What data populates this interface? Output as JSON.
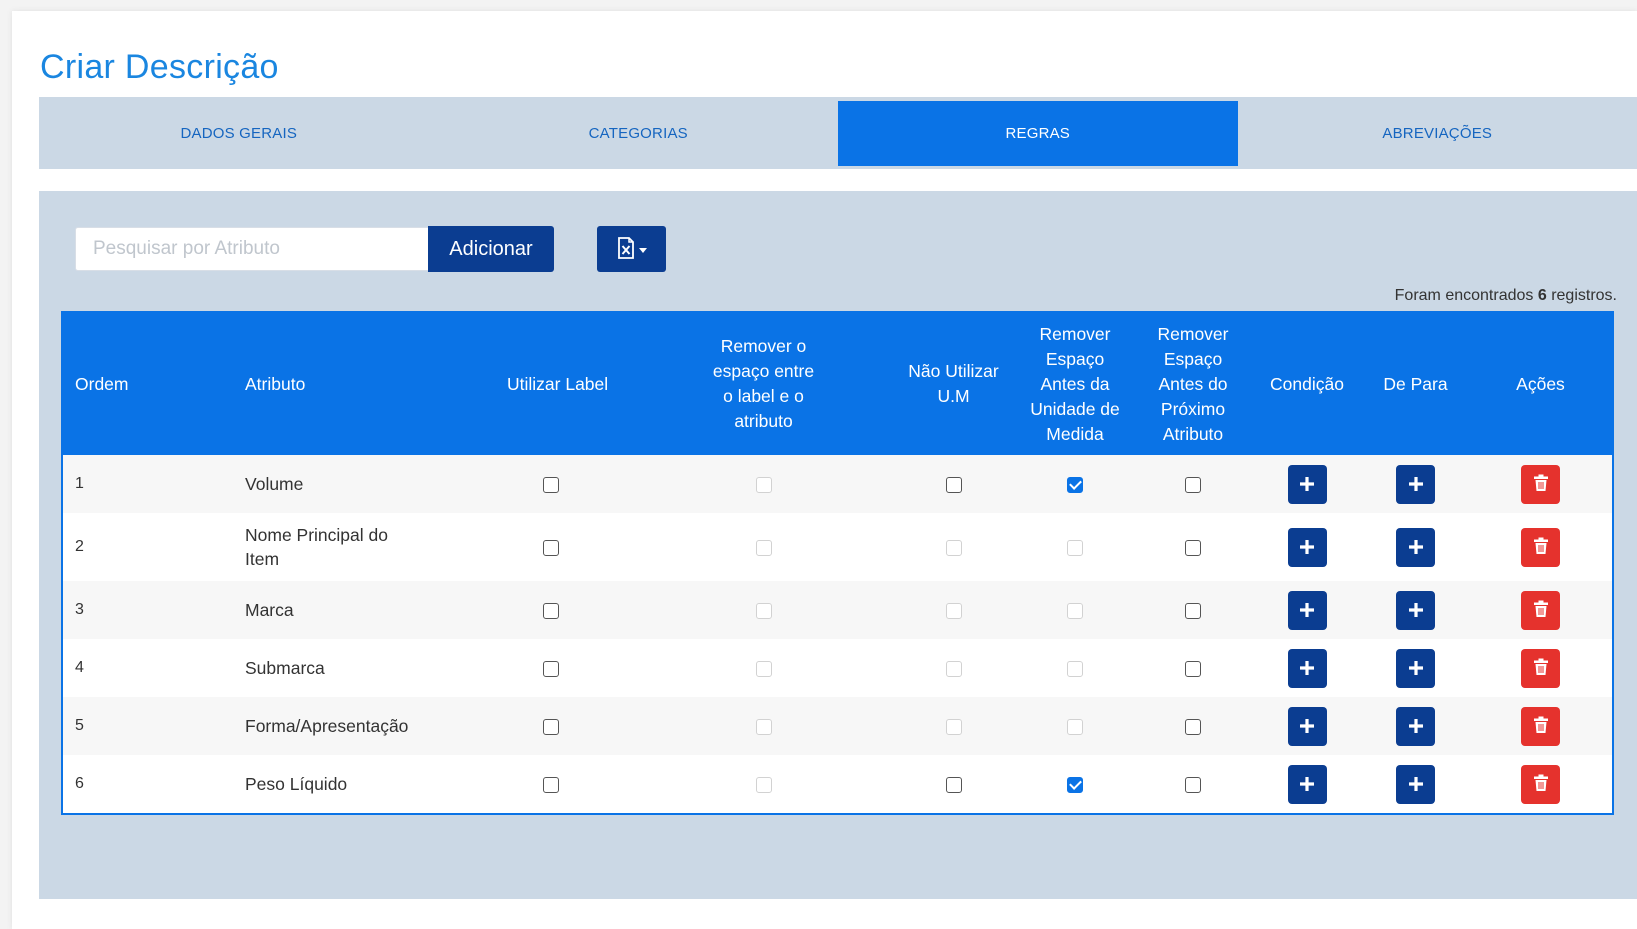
{
  "page": {
    "title": "Criar Descrição"
  },
  "tabs": [
    {
      "label": "DADOS GERAIS",
      "active": false
    },
    {
      "label": "CATEGORIAS",
      "active": false
    },
    {
      "label": "REGRAS",
      "active": true
    },
    {
      "label": "ABREVIAÇÕES",
      "active": false
    }
  ],
  "toolbar": {
    "search_placeholder": "Pesquisar por Atributo",
    "search_value": "",
    "add_label": "Adicionar",
    "export_icon": "excel-file-icon"
  },
  "records": {
    "prefix": "Foram encontrados",
    "count": "6",
    "suffix": "registros."
  },
  "table": {
    "headers": {
      "ordem": "Ordem",
      "atributo": "Atributo",
      "utilizar_label": "Utilizar Label",
      "remover_espaco_label": "Remover o espaço entre o label e o atributo",
      "nao_utilizar_um": "Não Utilizar U.M",
      "remover_espaco_unidade": "Remover Espaço Antes da Unidade de Medida",
      "remover_espaco_proximo": "Remover Espaço Antes do Próximo Atributo",
      "condicao": "Condição",
      "de_para": "De Para",
      "acoes": "Ações"
    },
    "checkbox_states": "unchecked | checked | disabled",
    "rows": [
      {
        "ordem": "1",
        "atributo": "Volume",
        "utilizar_label": "unchecked",
        "remover_espaco_label": "disabled",
        "nao_utilizar_um": "unchecked",
        "remover_espaco_unidade": "checked",
        "remover_espaco_proximo": "unchecked"
      },
      {
        "ordem": "2",
        "atributo": "Nome Principal do Item",
        "utilizar_label": "unchecked",
        "remover_espaco_label": "disabled",
        "nao_utilizar_um": "disabled",
        "remover_espaco_unidade": "disabled",
        "remover_espaco_proximo": "unchecked"
      },
      {
        "ordem": "3",
        "atributo": "Marca",
        "utilizar_label": "unchecked",
        "remover_espaco_label": "disabled",
        "nao_utilizar_um": "disabled",
        "remover_espaco_unidade": "disabled",
        "remover_espaco_proximo": "unchecked"
      },
      {
        "ordem": "4",
        "atributo": "Submarca",
        "utilizar_label": "unchecked",
        "remover_espaco_label": "disabled",
        "nao_utilizar_um": "disabled",
        "remover_espaco_unidade": "disabled",
        "remover_espaco_proximo": "unchecked"
      },
      {
        "ordem": "5",
        "atributo": "Forma/Apresentação",
        "utilizar_label": "unchecked",
        "remover_espaco_label": "disabled",
        "nao_utilizar_um": "disabled",
        "remover_espaco_unidade": "disabled",
        "remover_espaco_proximo": "unchecked"
      },
      {
        "ordem": "6",
        "atributo": "Peso Líquido",
        "utilizar_label": "unchecked",
        "remover_espaco_label": "disabled",
        "nao_utilizar_um": "unchecked",
        "remover_espaco_unidade": "checked",
        "remover_espaco_proximo": "unchecked"
      }
    ],
    "row_actions": {
      "condicao_icon": "plus-icon",
      "de_para_icon": "plus-icon",
      "acoes_icon": "trash-icon"
    }
  },
  "colors": {
    "title": "#1a86e0",
    "tab_active": "#0a73e6",
    "panel_bg": "#cbd8e5",
    "button_dark": "#0b3d91",
    "delete_red": "#e5322d"
  }
}
